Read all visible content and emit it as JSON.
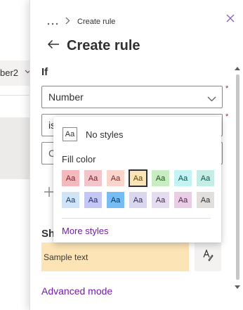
{
  "background": {
    "column_header_label": "ber2",
    "column_header_chevron": "chevron-down-icon"
  },
  "panel": {
    "breadcrumb": {
      "overflow_icon": "ellipsis-icon",
      "separator_icon": "chevron-right-icon",
      "current": "Create rule"
    },
    "close_icon": "close-icon",
    "back_icon": "arrow-left-icon",
    "title": "Create rule",
    "if_label": "If",
    "condition_column": {
      "value": "Number",
      "required_mark": "*"
    },
    "condition_operator": {
      "value": "is",
      "required_mark": "*"
    },
    "condition_value": {
      "value": "C"
    },
    "add_condition_icon": "plus-icon",
    "show_label": "Sh",
    "preview": {
      "text": "Sample text",
      "fill": "#fce4b6"
    },
    "edit_style_icon": "edit-style-icon",
    "advanced_mode": "Advanced mode"
  },
  "style_popup": {
    "no_styles": {
      "icon_text": "Aa",
      "label": "No styles"
    },
    "fill_color_label": "Fill color",
    "swatches_row1": [
      {
        "text": "Aa",
        "bg": "#f4b9bd",
        "fg": "#6e1d24"
      },
      {
        "text": "Aa",
        "bg": "#f3c5cb",
        "fg": "#6e1d24"
      },
      {
        "text": "Aa",
        "bg": "#fbd4cc",
        "fg": "#6e2b1f"
      },
      {
        "text": "Aa",
        "bg": "#fce4b6",
        "fg": "#5c4100",
        "selected": true
      },
      {
        "text": "Aa",
        "bg": "#c8edc2",
        "fg": "#1e4f17"
      },
      {
        "text": "Aa",
        "bg": "#c3f3f3",
        "fg": "#0c4f4f"
      },
      {
        "text": "Aa",
        "bg": "#c5ede6",
        "fg": "#0f4f45"
      }
    ],
    "swatches_row2": [
      {
        "text": "Aa",
        "bg": "#cfe4f7",
        "fg": "#0b3a66"
      },
      {
        "text": "Aa",
        "bg": "#c4c6f6",
        "fg": "#23256d"
      },
      {
        "text": "Aa",
        "bg": "#75bdf4",
        "fg": "#08345c"
      },
      {
        "text": "Aa",
        "bg": "#d9d6ee",
        "fg": "#2e2a5c"
      },
      {
        "text": "Aa",
        "bg": "#e6dcef",
        "fg": "#3c2a52"
      },
      {
        "text": "Aa",
        "bg": "#e8cde4",
        "fg": "#52244c"
      },
      {
        "text": "Aa",
        "bg": "#e1dfdd",
        "fg": "#323130"
      }
    ],
    "more_styles": "More styles"
  }
}
